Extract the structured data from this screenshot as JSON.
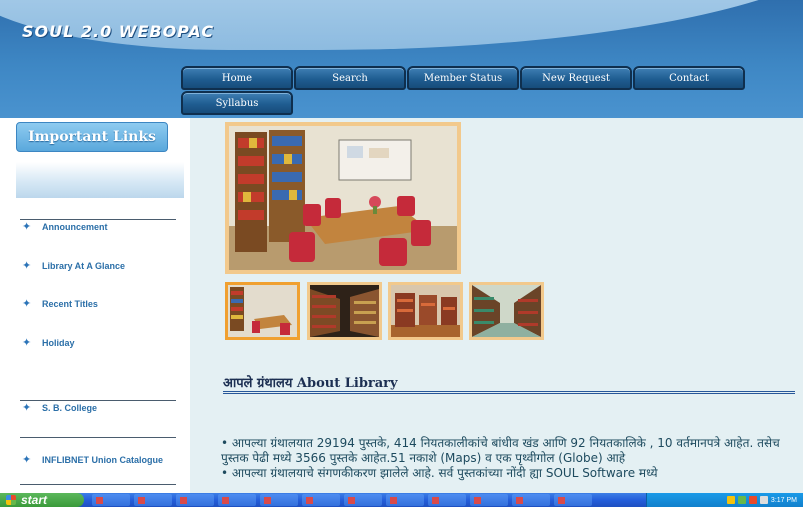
{
  "header": {
    "title": "SOUL 2.0 WEBOPAC"
  },
  "nav": {
    "items": [
      {
        "label": "Home"
      },
      {
        "label": "Search"
      },
      {
        "label": "Member Status"
      },
      {
        "label": "New Request"
      },
      {
        "label": "Contact"
      },
      {
        "label": "Syllabus"
      }
    ]
  },
  "sidebar": {
    "heading": "Important Links",
    "items": [
      {
        "label": "Announcement"
      },
      {
        "label": "Library At A Glance"
      },
      {
        "label": "Recent Titles"
      },
      {
        "label": "Holiday"
      },
      {
        "label": "S. B. College"
      },
      {
        "label": "INFLIBNET Union Catalogue"
      }
    ]
  },
  "main": {
    "about_title_marathi": "आपले ग्रंथालय",
    "about_title_english": "About Library",
    "about_paragraph_1": "• आपल्या ग्रंथालयात 29194 पुस्तके, 414 नियतकालीकांचे बांधीव खंड आणि 92 नियतकालिके , 10 वर्तमानपत्रे आहेत. तसेच पुस्तक पेढी मध्ये 3566 पुस्तके आहेत.51 नकाशे (Maps) व एक पृथ्वीगोल (Globe) आहे",
    "about_paragraph_2": "• आपल्या ग्रंथालयाचे संगणकीकरण झालेले आहे. सर्व पुस्तकांच्या नोंदी ह्या SOUL Software मध्ये"
  },
  "taskbar": {
    "start_label": "start",
    "clock": "3:17 PM"
  },
  "colors": {
    "header_blue": "#3e87c4",
    "nav_dark": "#1f5d91",
    "link_blue": "#2b6fa8",
    "content_bg": "#e4f0f3",
    "photo_frame": "#f2c98c"
  }
}
